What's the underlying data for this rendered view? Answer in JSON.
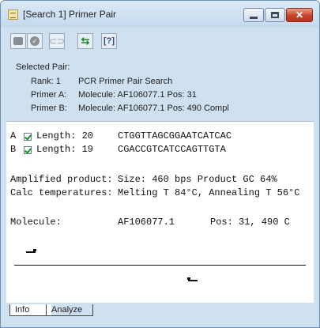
{
  "window": {
    "title": "[Search 1] Primer Pair",
    "icon": "document-icon"
  },
  "toolbar": {
    "buttons": [
      {
        "name": "stop",
        "icon": "stop-icon"
      },
      {
        "name": "accept",
        "icon": "check-circle-icon"
      },
      {
        "name": "link",
        "icon": "link-icon"
      },
      {
        "name": "swap",
        "icon": "swap-arrows-icon"
      },
      {
        "name": "help",
        "icon": "help-icon"
      }
    ]
  },
  "selected_pair": {
    "heading": "Selected Pair:",
    "rank_label": "Rank: 1",
    "rank_value": "PCR Primer Pair Search",
    "primer_a_label": "Primer A:",
    "primer_a_value": "Molecule: AF106077.1   Pos: 31",
    "primer_b_label": "Primer B:",
    "primer_b_value": "Molecule: AF106077.1   Pos: 490 Compl"
  },
  "primers": [
    {
      "letter": "A",
      "checked": true,
      "length": "Length: 20",
      "sequence": "CTGGTTAGCGGAATCATCAC"
    },
    {
      "letter": "B",
      "checked": true,
      "length": "Length: 19",
      "sequence": "CGACCGTCATCCAGTTGTA"
    }
  ],
  "product": {
    "amplified_label": "Amplified product:",
    "amplified_value": "Size: 460 bps   Product GC 64%",
    "calc_label": "Calc temperatures:",
    "calc_value": "Melting T 84°C, Annealing T 56°C",
    "molecule_label": "Molecule:",
    "molecule_value": "AF106077.1",
    "molecule_pos": "Pos: 31, 490 C"
  },
  "tabs": [
    {
      "label": "Info",
      "active": true
    },
    {
      "label": "Analyze",
      "active": false
    }
  ],
  "colors": {
    "frame": "#cfe0f1",
    "close_button": "#c8432b",
    "check_green": "#1a8a2a"
  }
}
